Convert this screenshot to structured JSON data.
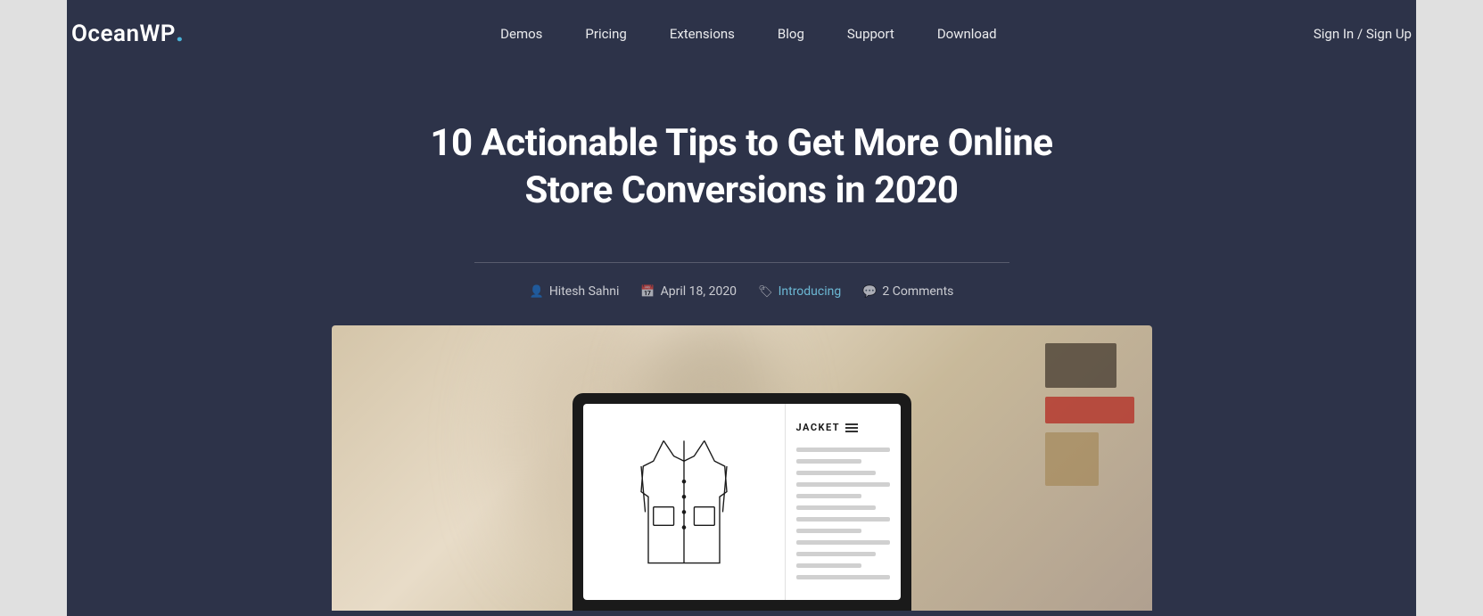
{
  "logo": {
    "text": "OceanWP",
    "dot": "."
  },
  "nav": {
    "links": [
      {
        "label": "Demos",
        "id": "demos"
      },
      {
        "label": "Pricing",
        "id": "pricing"
      },
      {
        "label": "Extensions",
        "id": "extensions"
      },
      {
        "label": "Blog",
        "id": "blog"
      },
      {
        "label": "Support",
        "id": "support"
      },
      {
        "label": "Download",
        "id": "download"
      }
    ],
    "auth": "Sign In / Sign Up"
  },
  "article": {
    "title": "10 Actionable Tips to Get More Online Store Conversions in 2020",
    "meta": {
      "author": "Hitesh Sahni",
      "date": "April 18, 2020",
      "category": "Introducing",
      "comments": "2 Comments"
    }
  },
  "screen": {
    "jacket_label": "JACKET"
  }
}
